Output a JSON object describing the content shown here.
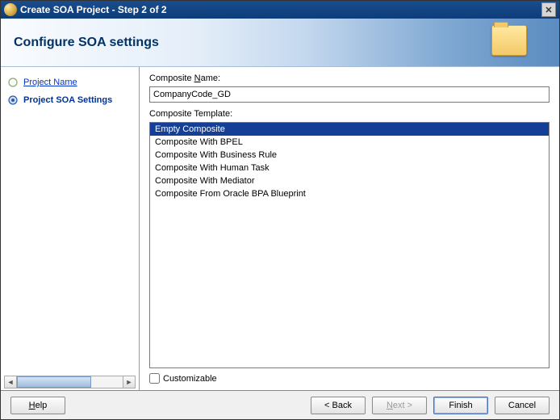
{
  "window": {
    "title": "Create SOA Project - Step 2 of 2"
  },
  "header": {
    "title": "Configure SOA settings"
  },
  "sidebar": {
    "steps": [
      {
        "label": "Project Name",
        "state": "past"
      },
      {
        "label": "Project SOA Settings",
        "state": "current"
      }
    ]
  },
  "form": {
    "name_label": "Composite Name:",
    "name_value": "CompanyCode_GD",
    "template_label": "Composite Template:",
    "templates": [
      "Empty Composite",
      "Composite With BPEL",
      "Composite With Business Rule",
      "Composite With Human Task",
      "Composite With Mediator",
      "Composite From Oracle BPA Blueprint"
    ],
    "selected_template": "Empty Composite",
    "customizable_label": "Customizable",
    "customizable_checked": false
  },
  "buttons": {
    "help": "Help",
    "back": "< Back",
    "next": "Next >",
    "finish": "Finish",
    "cancel": "Cancel"
  }
}
